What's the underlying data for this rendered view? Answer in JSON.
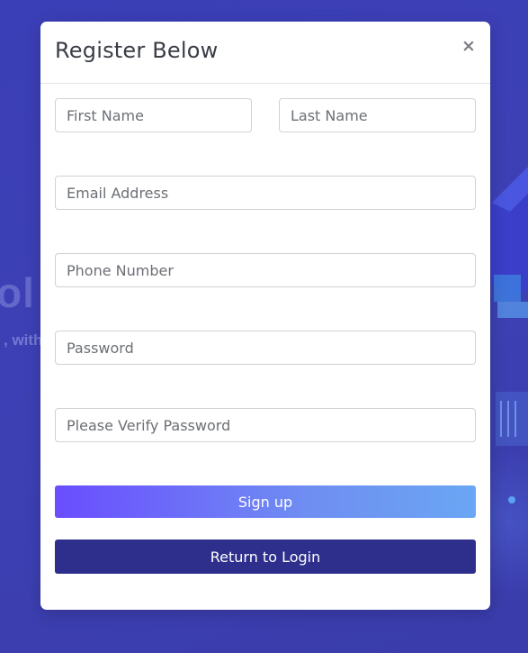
{
  "modal": {
    "title": "Register Below",
    "close_label": "×"
  },
  "form": {
    "first_name": {
      "placeholder": "First Name",
      "value": ""
    },
    "last_name": {
      "placeholder": "Last Name",
      "value": ""
    },
    "email": {
      "placeholder": "Email Address",
      "value": ""
    },
    "phone": {
      "placeholder": "Phone Number",
      "value": ""
    },
    "password": {
      "placeholder": "Password",
      "value": ""
    },
    "verify_password": {
      "placeholder": "Please Verify Password",
      "value": ""
    }
  },
  "buttons": {
    "signup_label": "Sign up",
    "return_login_label": "Return to Login"
  },
  "background": {
    "hero_fragment": "ol",
    "sub_fragment": ", with"
  },
  "colors": {
    "backdrop": "#3b3fb7",
    "signup_gradient_start": "#6a4dff",
    "signup_gradient_end": "#6aa6f3",
    "return_login_bg": "#2e2f8d"
  }
}
